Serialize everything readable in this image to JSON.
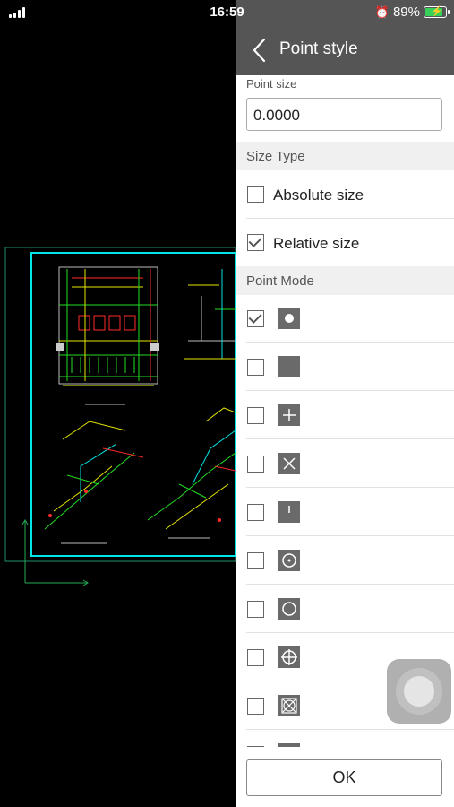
{
  "status_bar": {
    "time": "16:59",
    "battery_percent": "89%",
    "battery_level": 0.89,
    "alarm_icon": "alarm-clock-icon",
    "signal_icon": "cellular-signal-icon"
  },
  "drawing": {
    "plan_caption": "",
    "left_detail_caption": "",
    "right_detail_caption": ""
  },
  "panel": {
    "title": "Point style",
    "back_icon": "chevron-left-icon",
    "point_size": {
      "label": "Point size",
      "value": "0.0000"
    },
    "size_type": {
      "header": "Size Type",
      "options": [
        {
          "label": "Absolute size",
          "checked": false
        },
        {
          "label": "Relative size",
          "checked": true
        }
      ]
    },
    "point_mode": {
      "header": "Point Mode",
      "modes": [
        {
          "icon": "filled-dot-icon",
          "checked": true
        },
        {
          "icon": "blank-square-icon",
          "checked": false
        },
        {
          "icon": "plus-icon",
          "checked": false
        },
        {
          "icon": "x-icon",
          "checked": false
        },
        {
          "icon": "vertical-tick-icon",
          "checked": false
        },
        {
          "icon": "circle-dot-icon",
          "checked": false
        },
        {
          "icon": "circle-icon",
          "checked": false
        },
        {
          "icon": "circle-plus-icon",
          "checked": false
        },
        {
          "icon": "circle-x-icon",
          "checked": false
        },
        {
          "icon": "square-point-icon",
          "checked": false
        }
      ]
    },
    "ok_label": "OK"
  },
  "colors": {
    "header_bg": "#555555",
    "section_bg": "#f0f0f0",
    "battery_green": "#37d159",
    "cad_cyan": "#00e5e5",
    "cad_green": "#22dd22",
    "cad_red": "#ff2a2a",
    "cad_yellow": "#e6e600"
  }
}
